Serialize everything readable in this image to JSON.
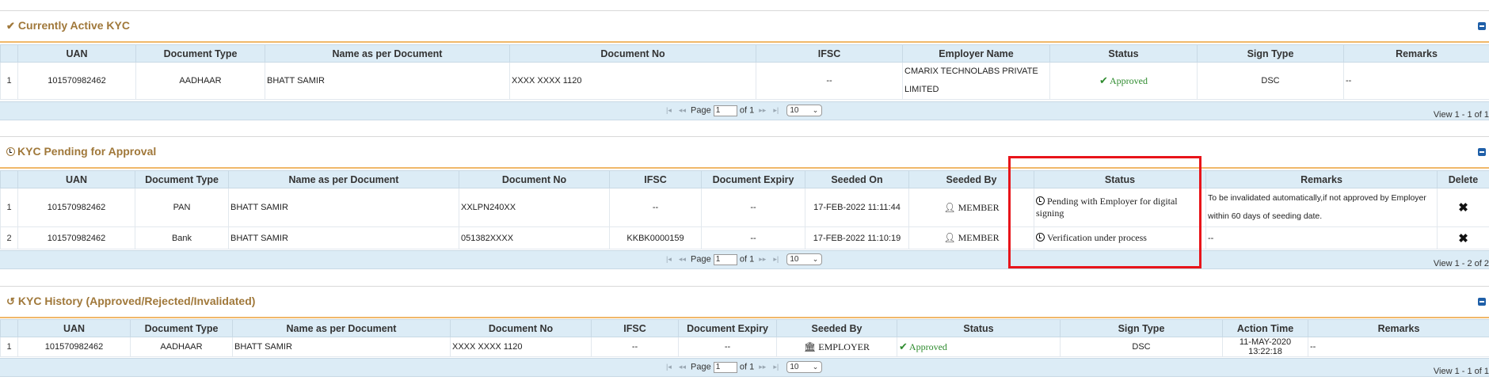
{
  "active": {
    "title": "Currently Active KYC",
    "columns": [
      "UAN",
      "Document Type",
      "Name as per Document",
      "Document No",
      "IFSC",
      "Employer Name",
      "Status",
      "Sign Type",
      "Remarks"
    ],
    "rows": [
      {
        "num": "1",
        "uan": "101570982462",
        "doc_type": "AADHAAR",
        "name": "BHATT SAMIR",
        "doc_no": "XXXX XXXX 1120",
        "ifsc": "--",
        "employer": "CMARIX TECHNOLABS PRIVATE LIMITED",
        "status": "Approved",
        "sign_type": "DSC",
        "remarks": "--"
      }
    ],
    "pager": {
      "page_label": "Page",
      "page_value": "1",
      "of_label": "of 1",
      "rows_value": "10",
      "view": "View 1 - 1 of 1"
    }
  },
  "pending": {
    "title": "KYC Pending for Approval",
    "columns": [
      "UAN",
      "Document Type",
      "Name as per Document",
      "Document No",
      "IFSC",
      "Document Expiry",
      "Seeded On",
      "Seeded By",
      "Status",
      "Remarks",
      "Delete"
    ],
    "rows": [
      {
        "num": "1",
        "uan": "101570982462",
        "doc_type": "PAN",
        "name": "BHATT SAMIR",
        "doc_no": "XXLPN240XX",
        "ifsc": "--",
        "expiry": "--",
        "seeded_on": "17-FEB-2022 11:11:44",
        "seeded_by": "MEMBER",
        "status": "Pending with Employer for digital signing",
        "remarks": "To be invalidated automatically,if not approved by Employer within 60 days of seeding date."
      },
      {
        "num": "2",
        "uan": "101570982462",
        "doc_type": "Bank",
        "name": "BHATT SAMIR",
        "doc_no": "051382XXXX",
        "ifsc": "KKBK0000159",
        "expiry": "--",
        "seeded_on": "17-FEB-2022 11:10:19",
        "seeded_by": "MEMBER",
        "status": "Verification under process",
        "remarks": "--"
      }
    ],
    "pager": {
      "page_label": "Page",
      "page_value": "1",
      "of_label": "of 1",
      "rows_value": "10",
      "view": "View 1 - 2 of 2"
    }
  },
  "history": {
    "title": "KYC History (Approved/Rejected/Invalidated)",
    "columns": [
      "UAN",
      "Document Type",
      "Name as per Document",
      "Document No",
      "IFSC",
      "Document Expiry",
      "Seeded By",
      "Status",
      "Sign Type",
      "Action Time",
      "Remarks"
    ],
    "rows": [
      {
        "num": "1",
        "uan": "101570982462",
        "doc_type": "AADHAAR",
        "name": "BHATT SAMIR",
        "doc_no": "XXXX XXXX 1120",
        "ifsc": "--",
        "expiry": "--",
        "seeded_by": "EMPLOYER",
        "status": "Approved",
        "sign_type": "DSC",
        "action_time": "11-MAY-2020 13:22:18",
        "remarks": "--"
      }
    ],
    "pager": {
      "page_label": "Page",
      "page_value": "1",
      "of_label": "of 1",
      "rows_value": "10",
      "view": "View 1 - 1 of 1"
    }
  },
  "colors": {
    "accent_title": "#a0783a",
    "header_bg": "#dcecf6",
    "approved": "#2e8b2e",
    "highlight": "#e8141a"
  }
}
